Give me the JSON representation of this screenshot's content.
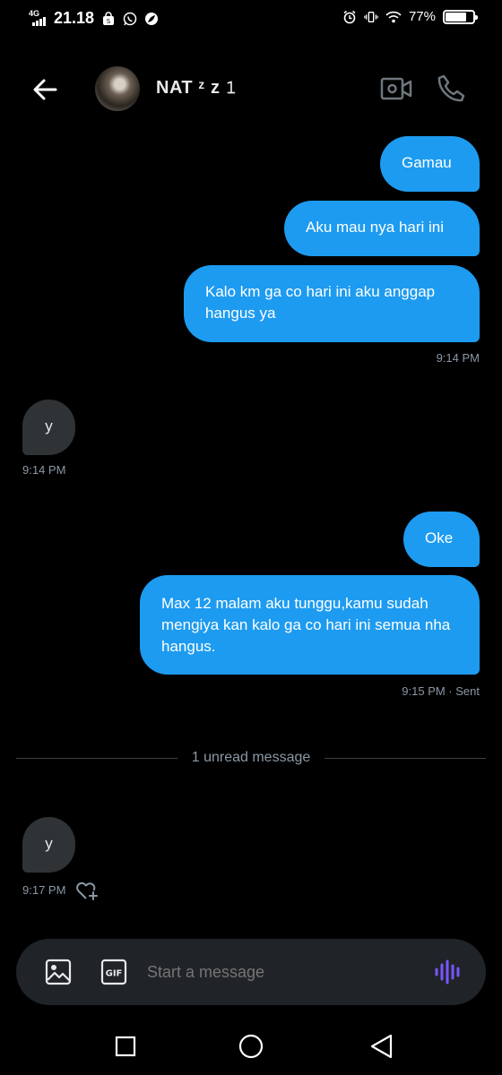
{
  "status_bar": {
    "network": "4G",
    "time": "21.18",
    "battery": "77%",
    "battery_level": 0.77
  },
  "header": {
    "contact_name": "NAT ᶻ z 𝟷"
  },
  "messages": [
    {
      "direction": "out",
      "text": "Gamau"
    },
    {
      "direction": "out",
      "text": "Aku mau nya hari ini"
    },
    {
      "direction": "out",
      "text": "Kalo km ga co hari ini aku anggap hangus ya"
    },
    {
      "direction": "out_time",
      "text": "9:14 PM"
    },
    {
      "direction": "in",
      "text": "y"
    },
    {
      "direction": "in_time",
      "text": "9:14 PM"
    },
    {
      "direction": "out",
      "text": "Oke"
    },
    {
      "direction": "out",
      "text": "Max 12 malam aku tunggu,kamu sudah mengiya kan kalo ga co hari ini semua nha hangus."
    },
    {
      "direction": "out_time",
      "text": "9:15 PM · Sent"
    },
    {
      "direction": "in",
      "text": "y"
    },
    {
      "direction": "in_time",
      "text": "9:17 PM"
    }
  ],
  "unread_divider": "1 unread message",
  "composer": {
    "placeholder": "Start a message",
    "gif_label": "GIF"
  },
  "colors": {
    "accent": "#1d9bf0",
    "incoming_bubble": "#2f3336",
    "voice_icon": "#7856ff"
  },
  "icons": {
    "back": "arrow-left-icon",
    "video": "video-camera-icon",
    "call": "phone-icon",
    "image": "image-icon",
    "gif": "gif-icon",
    "voice": "voice-wave-icon",
    "react": "heart-plus-icon"
  }
}
